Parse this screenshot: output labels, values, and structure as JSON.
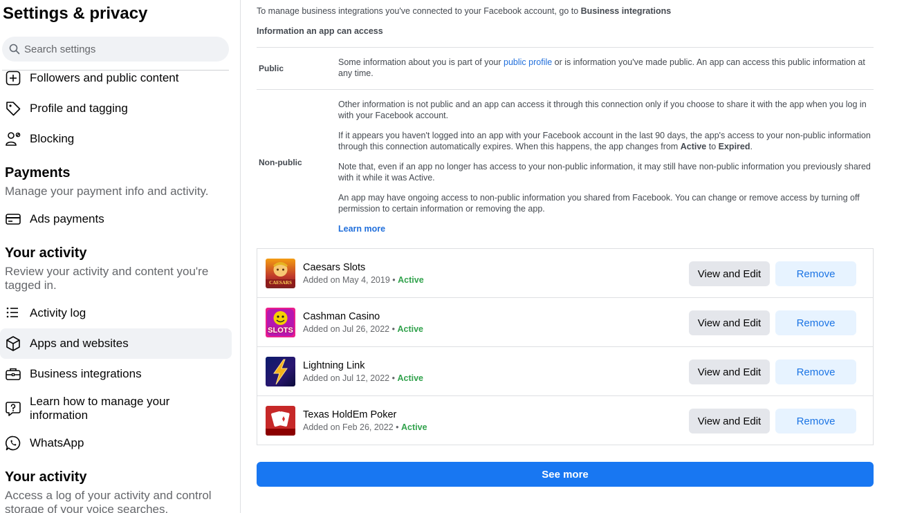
{
  "sidebar": {
    "title": "Settings & privacy",
    "search_placeholder": "Search settings",
    "items_top": [
      {
        "label": "Followers and public content",
        "icon": "plus-square-icon"
      },
      {
        "label": "Profile and tagging",
        "icon": "tag-icon"
      },
      {
        "label": "Blocking",
        "icon": "block-user-icon"
      }
    ],
    "payments": {
      "heading": "Payments",
      "description": "Manage your payment info and activity.",
      "items": [
        {
          "label": "Ads payments",
          "icon": "card-icon"
        }
      ]
    },
    "activity": {
      "heading": "Your activity",
      "description": "Review your activity and content you're tagged in.",
      "items": [
        {
          "label": "Activity log",
          "icon": "list-icon"
        },
        {
          "label": "Apps and websites",
          "icon": "cube-icon",
          "selected": true
        },
        {
          "label": "Business integrations",
          "icon": "briefcase-icon"
        },
        {
          "label": "Learn how to manage your information",
          "icon": "question-chat-icon"
        },
        {
          "label": "WhatsApp",
          "icon": "whatsapp-icon"
        }
      ]
    },
    "activity2": {
      "heading": "Your activity",
      "description": "Access a log of your activity and control storage of your voice searches."
    }
  },
  "main": {
    "intro_prefix": "To manage business integrations you've connected to your Facebook account, go to ",
    "intro_link": "Business integrations",
    "info_heading": "Information an app can access",
    "public": {
      "label": "Public",
      "text_prefix": "Some information about you is part of your ",
      "link": "public profile",
      "text_suffix": " or is information you've made public. An app can access this public information at any time."
    },
    "nonpublic": {
      "label": "Non-public",
      "p1": "Other information is not public and an app can access it through this connection only if you choose to share it with the app when you log in with your Facebook account.",
      "p2_prefix": "If it appears you haven't logged into an app with your Facebook account in the last 90 days, the app's access to your non-public information through this connection automatically expires. When this happens, the app changes from ",
      "p2_active": "Active",
      "p2_to": " to ",
      "p2_expired": "Expired",
      "p2_end": ".",
      "p3": "Note that, even if an app no longer has access to your non-public information, it may still have non-public information you previously shared with it while it was Active.",
      "p4": "An app may have ongoing access to non-public information you shared from Facebook. You can change or remove access by turning off permission to certain information or removing the app.",
      "learn_more": "Learn more"
    },
    "apps": [
      {
        "name": "Caesars Slots",
        "added": "Added on May 4, 2019",
        "status": "Active",
        "logo_text": "CAESARS",
        "edit": "View and Edit",
        "remove": "Remove"
      },
      {
        "name": "Cashman Casino",
        "added": "Added on Jul 26, 2022",
        "status": "Active",
        "logo_text": "SLOTS",
        "edit": "View and Edit",
        "remove": "Remove"
      },
      {
        "name": "Lightning Link",
        "added": "Added on Jul 12, 2022",
        "status": "Active",
        "edit": "View and Edit",
        "remove": "Remove"
      },
      {
        "name": "Texas HoldEm Poker",
        "added": "Added on Feb 26, 2022",
        "status": "Active",
        "edit": "View and Edit",
        "remove": "Remove"
      }
    ],
    "dot": "•",
    "see_more": "See more"
  }
}
